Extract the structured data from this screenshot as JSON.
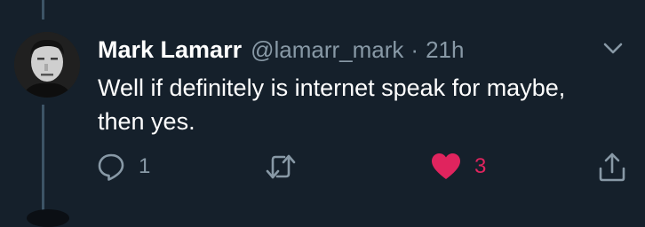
{
  "tweet": {
    "display_name": "Mark Lamarr",
    "handle": "@lamarr_mark",
    "separator": "·",
    "time": "21h",
    "text": "Well if definitely is internet speak for maybe, then yes."
  },
  "actions": {
    "reply_count": "1",
    "retweet_count": "",
    "like_count": "3"
  },
  "icons": {
    "reply": "reply-icon",
    "retweet": "retweet-icon",
    "like": "heart-icon",
    "share": "share-icon",
    "menu": "chevron-down-icon"
  },
  "colors": {
    "background": "#15202b",
    "secondary_text": "#8899a6",
    "like_active": "#e0245e",
    "thread_line": "#3d5466"
  }
}
